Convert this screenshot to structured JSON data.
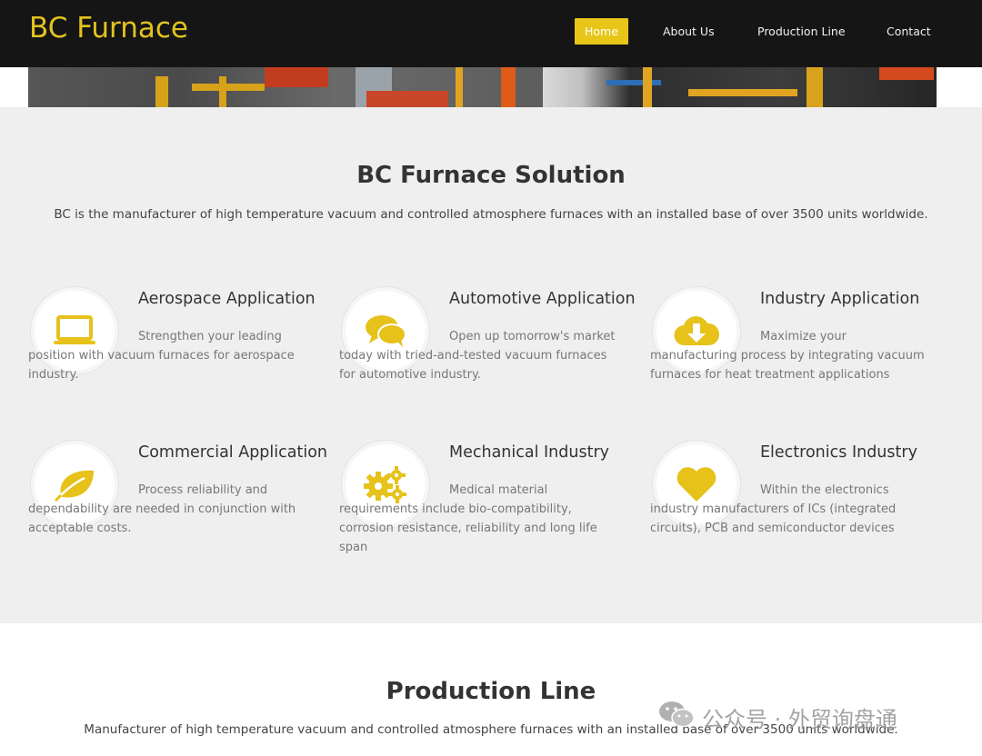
{
  "brand": {
    "name": "BC Furnace",
    "accent": "#e3c21f"
  },
  "nav": {
    "items": [
      {
        "label": "Home",
        "active": true
      },
      {
        "label": "About Us",
        "active": false
      },
      {
        "label": "Production Line",
        "active": false
      },
      {
        "label": "Contact",
        "active": false
      }
    ]
  },
  "solution": {
    "title": "BC Furnace Solution",
    "description": "BC is the manufacturer of high temperature vacuum and controlled atmosphere furnaces with an installed base of over 3500 units worldwide.",
    "features": [
      {
        "icon": "laptop-icon",
        "title": "Aerospace Application",
        "text": "Strengthen your leading position with vacuum furnaces for aerospace industry."
      },
      {
        "icon": "chat-bubbles-icon",
        "title": "Automotive Application",
        "text": "Open up tomorrow's market today with tried-and-tested vacuum furnaces for automotive industry."
      },
      {
        "icon": "cloud-download-icon",
        "title": "Industry Application",
        "text": "Maximize your manufacturing process by integrating vacuum furnaces for heat treatment applications"
      },
      {
        "icon": "leaf-icon",
        "title": "Commercial Application",
        "text": "Process reliability and dependability are needed in conjunction with acceptable costs."
      },
      {
        "icon": "gears-icon",
        "title": "Mechanical Industry",
        "text": "Medical material requirements include bio-compatibility, corrosion resistance, reliability and long life span"
      },
      {
        "icon": "heart-icon",
        "title": "Electronics Industry",
        "text": "Within the electronics industry manufacturers of ICs (integrated circuits), PCB and semiconductor devices"
      }
    ]
  },
  "production": {
    "title": "Production Line",
    "description": "Manufacturer of high temperature vacuum and controlled atmosphere furnaces with an installed base of over 3500 units worldwide."
  },
  "watermark": {
    "text": "公众号 · 外贸询盘通",
    "icon": "wechat-icon"
  }
}
